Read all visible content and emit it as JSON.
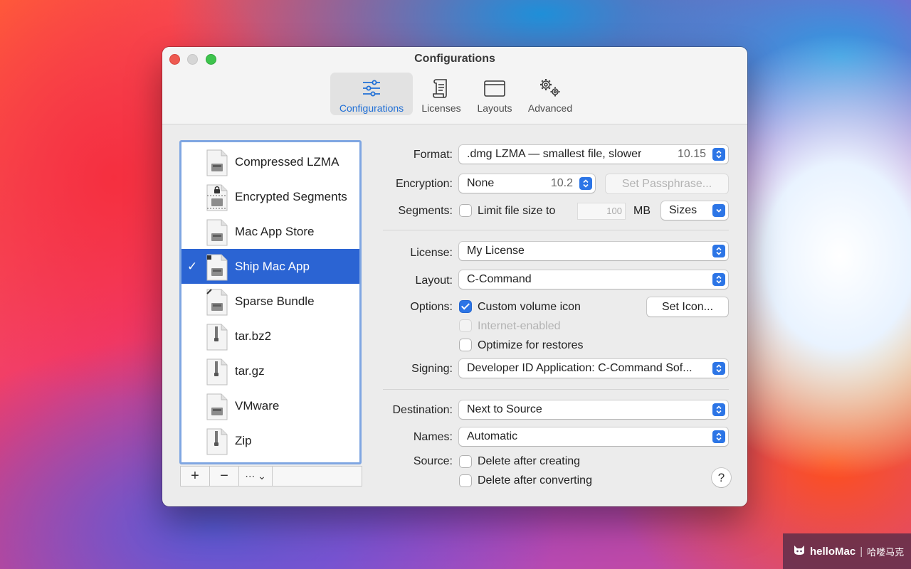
{
  "window": {
    "title": "Configurations"
  },
  "toolbar": {
    "tabs": [
      {
        "label": "Configurations",
        "icon": "sliders-icon",
        "active": true
      },
      {
        "label": "Licenses",
        "icon": "scroll-icon",
        "active": false
      },
      {
        "label": "Layouts",
        "icon": "window-icon",
        "active": false
      },
      {
        "label": "Advanced",
        "icon": "gears-icon",
        "active": false
      }
    ]
  },
  "sidebar": {
    "items": [
      {
        "label": "Compressed LZMA",
        "selected": false
      },
      {
        "label": "Encrypted Segments",
        "selected": false
      },
      {
        "label": "Mac App Store",
        "selected": false
      },
      {
        "label": "Ship Mac App",
        "selected": true
      },
      {
        "label": "Sparse Bundle",
        "selected": false
      },
      {
        "label": "tar.bz2",
        "selected": false
      },
      {
        "label": "tar.gz",
        "selected": false
      },
      {
        "label": "VMware",
        "selected": false
      },
      {
        "label": "Zip",
        "selected": false
      }
    ],
    "checkmark": "✓",
    "add_label": "+",
    "remove_label": "−",
    "more_label": "⋯ ⌄"
  },
  "form": {
    "format_label": "Format:",
    "format_value": ".dmg LZMA — smallest file, slower",
    "format_version": "10.15",
    "encryption_label": "Encryption:",
    "encryption_value": "None",
    "encryption_version": "10.2",
    "set_passphrase_label": "Set Passphrase...",
    "segments_label": "Segments:",
    "limit_size_label": "Limit file size to",
    "limit_size_value": "100",
    "limit_size_unit": "MB",
    "sizes_value": "Sizes",
    "license_label": "License:",
    "license_value": "My License",
    "layout_label": "Layout:",
    "layout_value": "C-Command",
    "options_label": "Options:",
    "custom_volume_icon_label": "Custom volume icon",
    "set_icon_label": "Set Icon...",
    "internet_enabled_label": "Internet-enabled",
    "optimize_restores_label": "Optimize for restores",
    "signing_label": "Signing:",
    "signing_value": "Developer ID Application: C-Command Sof...",
    "destination_label": "Destination:",
    "destination_value": "Next to Source",
    "names_label": "Names:",
    "names_value": "Automatic",
    "source_label": "Source:",
    "delete_after_creating_label": "Delete after creating",
    "delete_after_converting_label": "Delete after converting",
    "help_label": "?"
  },
  "watermark": {
    "brand": "helloMac",
    "separator": "|",
    "cn": "哈喽马克"
  },
  "colors": {
    "accent": "#2c75e6",
    "selection": "#2b64d3",
    "list_focus_ring": "#7fa6e2"
  }
}
